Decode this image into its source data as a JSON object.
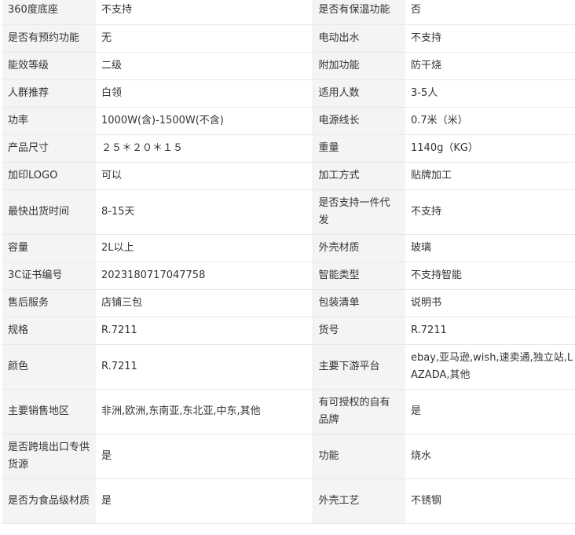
{
  "rows": [
    {
      "k1": "360度底座",
      "v1": "不支持",
      "k2": "是否有保温功能",
      "v2": "否"
    },
    {
      "k1": "是否有预约功能",
      "v1": "无",
      "k2": "电动出水",
      "v2": "不支持"
    },
    {
      "k1": "能效等级",
      "v1": "二级",
      "k2": "附加功能",
      "v2": "防干烧"
    },
    {
      "k1": "人群推荐",
      "v1": "白领",
      "k2": "适用人数",
      "v2": "3-5人"
    },
    {
      "k1": "功率",
      "v1": "1000W(含)-1500W(不含)",
      "k2": "电源线长",
      "v2": "0.7米（米）"
    },
    {
      "k1": "产品尺寸",
      "v1": "２５＊２０＊１５",
      "k2": "重量",
      "v2": "1140g（KG）"
    },
    {
      "k1": "加印LOGO",
      "v1": "可以",
      "k2": "加工方式",
      "v2": "贴牌加工"
    },
    {
      "k1": "最快出货时间",
      "v1": "8-15天",
      "k2": "是否支持一件代发",
      "v2": "不支持"
    },
    {
      "k1": "容量",
      "v1": "2L以上",
      "k2": "外壳材质",
      "v2": "玻璃"
    },
    {
      "k1": "3C证书编号",
      "v1": "2023180717047758",
      "k2": "智能类型",
      "v2": "不支持智能"
    },
    {
      "k1": "售后服务",
      "v1": "店铺三包",
      "k2": "包装清单",
      "v2": "说明书"
    },
    {
      "k1": "规格",
      "v1": "R.7211",
      "k2": "货号",
      "v2": "R.7211"
    },
    {
      "k1": "颜色",
      "v1": "R.7211",
      "k2": "主要下游平台",
      "v2": "ebay,亚马逊,wish,速卖通,独立站,LAZADA,其他"
    },
    {
      "k1": "主要销售地区",
      "v1": "非洲,欧洲,东南亚,东北亚,中东,其他",
      "k2": "有可授权的自有品牌",
      "v2": "是"
    },
    {
      "k1": "是否跨境出口专供货源",
      "v1": "是",
      "k2": "功能",
      "v2": "烧水"
    },
    {
      "k1": "是否为食品级材质",
      "v1": "是",
      "k2": "外壳工艺",
      "v2": "不锈钢"
    }
  ]
}
